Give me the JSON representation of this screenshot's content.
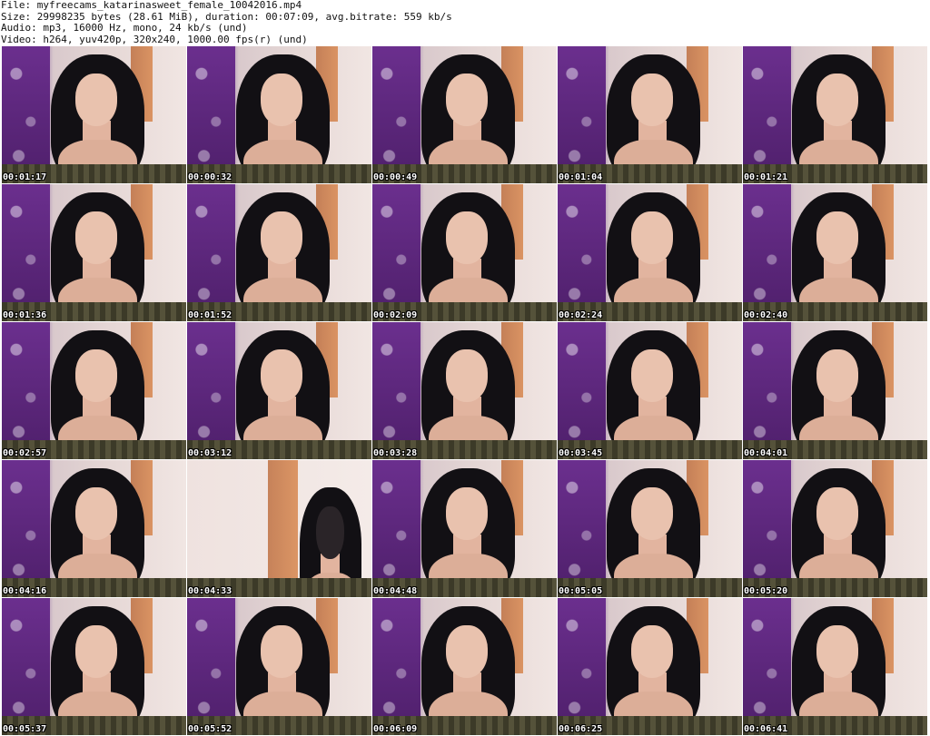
{
  "header": {
    "file_line": "File: myfreecams_katarinasweet_female_10042016.mp4",
    "size_line": "Size: 29998235 bytes (28.61 MiB), duration: 00:07:09, avg.bitrate: 559 kb/s",
    "audio_line": "Audio: mp3, 16000 Hz, mono, 24 kb/s (und)",
    "video_line": "Video: h264, yuv420p, 320x240, 1000.00 fps(r) (und)"
  },
  "thumbnails": [
    {
      "timestamp": "00:01:17"
    },
    {
      "timestamp": "00:00:32"
    },
    {
      "timestamp": "00:00:49"
    },
    {
      "timestamp": "00:01:04"
    },
    {
      "timestamp": "00:01:21"
    },
    {
      "timestamp": "00:01:36"
    },
    {
      "timestamp": "00:01:52"
    },
    {
      "timestamp": "00:02:09"
    },
    {
      "timestamp": "00:02:24"
    },
    {
      "timestamp": "00:02:40"
    },
    {
      "timestamp": "00:02:57"
    },
    {
      "timestamp": "00:03:12"
    },
    {
      "timestamp": "00:03:28"
    },
    {
      "timestamp": "00:03:45"
    },
    {
      "timestamp": "00:04:01"
    },
    {
      "timestamp": "00:04:16"
    },
    {
      "timestamp": "00:04:33"
    },
    {
      "timestamp": "00:04:48"
    },
    {
      "timestamp": "00:05:05"
    },
    {
      "timestamp": "00:05:20"
    },
    {
      "timestamp": "00:05:37"
    },
    {
      "timestamp": "00:05:52"
    },
    {
      "timestamp": "00:06:09"
    },
    {
      "timestamp": "00:06:25"
    },
    {
      "timestamp": "00:06:41"
    }
  ]
}
